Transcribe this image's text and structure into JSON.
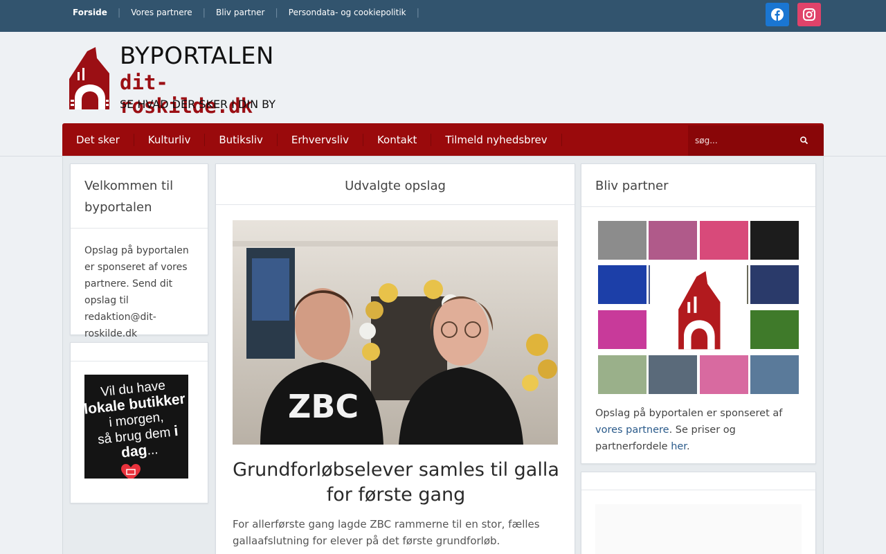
{
  "topnav": {
    "items": [
      {
        "label": "Forside"
      },
      {
        "label": "Vores partnere"
      },
      {
        "label": "Bliv partner"
      },
      {
        "label": "Persondata- og cookiepolitik"
      }
    ],
    "social": [
      {
        "icon": "facebook-icon",
        "color": "#1a76d2"
      },
      {
        "icon": "instagram-icon",
        "color": "#e0436a"
      }
    ]
  },
  "logo": {
    "line1": "BYPORTALEN",
    "line2": "dit-roskilde.dk",
    "line3": "SE HVAD DER SKER I DIN BY",
    "color": "#9b0f14"
  },
  "mainnav": {
    "items": [
      {
        "label": "Det sker"
      },
      {
        "label": "Kulturliv"
      },
      {
        "label": "Butiksliv"
      },
      {
        "label": "Erhvervsliv"
      },
      {
        "label": "Kontakt"
      },
      {
        "label": "Tilmeld nyhedsbrev"
      }
    ],
    "search_placeholder": "søg...",
    "color": "#9a0a0c"
  },
  "left": {
    "welcome_title": "Velkommen til byportalen",
    "welcome_text": "Opslag på byportalen er sponseret af vores partnere. Send dit opslag til redaktion@dit-roskilde.dk",
    "ad": {
      "line1": "Vil du have",
      "line2": "lokale butikker",
      "line3": "i morgen,",
      "line4": "så brug dem",
      "line5": "i dag",
      "line6": "..."
    }
  },
  "center": {
    "title": "Udvalgte opslag",
    "image_shirt_text": "ZBC",
    "post_title": "Grundforløbselever samles til galla for første gang",
    "post_excerpt": "For allerførste gang lagde ZBC rammerne til en stor, fælles gallaafslutning for elever på det første grundforløb."
  },
  "right": {
    "title": "Bliv partner",
    "text_before": "Opslag på byportalen er sponseret af ",
    "link1": "vores partnere",
    "text_mid": ". Se priser og partnerfordele ",
    "link2": "her",
    "text_after": ".",
    "tile_colors": [
      "#8c8c8c",
      "#b05a8a",
      "#d84a7a",
      "#1c1c1c",
      "#1c3fa8",
      "#2a3a6a",
      "#c83a9a",
      "#3f7a2a",
      "#9ab08a",
      "#5a6a7a",
      "#d86aa0",
      "#5a7a9a",
      "#4a5a8a",
      "#6a6a5a"
    ]
  }
}
